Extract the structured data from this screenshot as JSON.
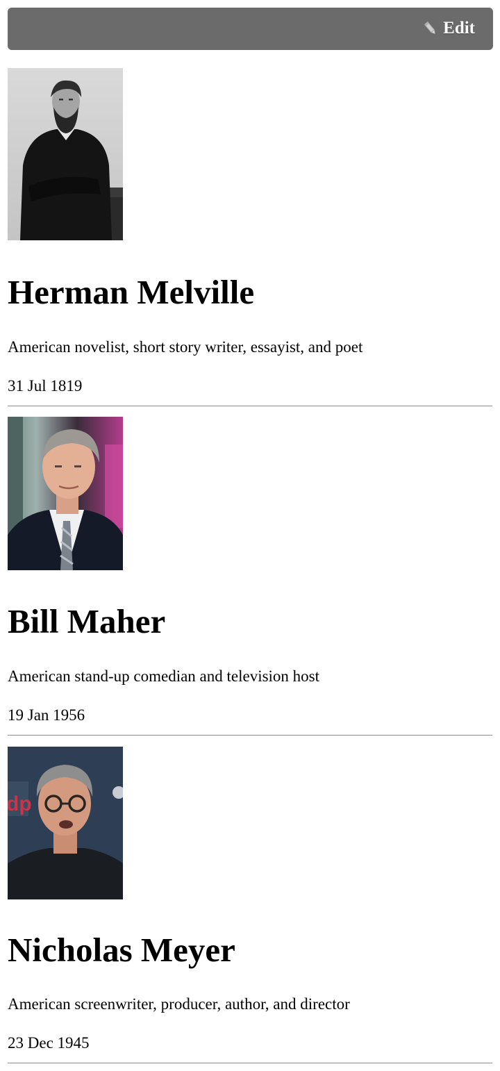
{
  "toolbar": {
    "edit_label": "Edit",
    "edit_icon": "pencil-icon"
  },
  "people": [
    {
      "name": "Herman Melville",
      "description": "American novelist, short story writer, essayist, and poet",
      "date": "31 Jul 1819",
      "photo_style": "black-and-white"
    },
    {
      "name": "Bill Maher",
      "description": "American stand-up comedian and television host",
      "date": "19 Jan 1956",
      "photo_style": "color"
    },
    {
      "name": "Nicholas Meyer",
      "description": "American screenwriter, producer, author, and director",
      "date": "23 Dec 1945",
      "photo_style": "color"
    }
  ],
  "colors": {
    "toolbar_bg": "#6b6b6b",
    "toolbar_text": "#ffffff",
    "divider": "#8a8a8a"
  }
}
